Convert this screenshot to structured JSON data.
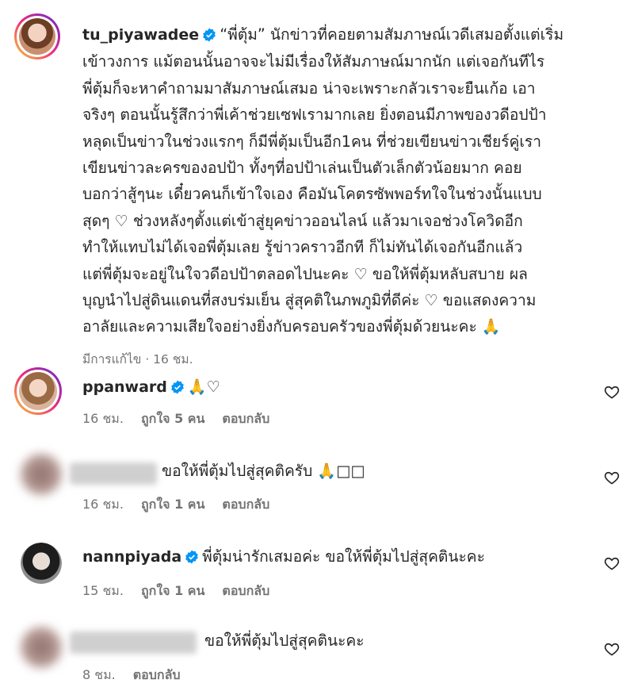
{
  "post": {
    "username": "tu_piyawadee",
    "text_lines": [
      "“พี่ตุ้ม” นักข่าวที่คอยตามสัมภาษณ์เวดีเสมอตั้งแต่เริ่ม",
      "เข้าวงการ แม้ตอนนั้นอาจจะไม่มีเรื่องให้สัมภาษณ์มากนัก แต่เจอกันทีไร",
      "พี่ตุ้มก็จะหาคำถามมาสัมภาษณ์เสมอ น่าจะเพราะกลัวเราจะยืนเก้อ เอา",
      "จริงๆ ตอนนั้นรู้สึกว่าพี่เค้าช่วยเซฟเรามากเลย ยิ่งตอนมีภาพของวดีอปป้า",
      "หลุดเป็นข่าวในช่วงแรกๆ ก็มีพี่ตุ้มเป็นอีก1คน ที่ช่วยเขียนข่าวเชียร์คู่เรา",
      "เขียนข่าวละครของอปป้า ทั้งๆที่อปป้าเล่นเป็นตัวเล็กตัวน้อยมาก คอย",
      "บอกว่าสู้ๆนะ เดี๋ยวคนก็เข้าใจเอง คือมันโคตรซัพพอร์ทใจในช่วงนั้นแบบ",
      "สุดๆ ♡ ช่วงหลังๆตั้งแต่เข้าสู่ยุคข่าวออนไลน์ แล้วมาเจอช่วงโควิดอีก",
      "ทำให้แทบไม่ได้เจอพี่ตุ้มเลย รู้ข่าวคราวอีกที ก็ไม่ทันได้เจอกันอีกแล้ว",
      "แต่พี่ตุ้มจะอยู่ในใจวดีอปป้าตลอดไปนะคะ ♡ ขอให้พี่ตุ้มหลับสบาย ผล",
      "บุญนำไปสู่ดินแดนที่สงบร่มเย็น สู่สุคติในภพภูมิที่ดีค่ะ ♡ ขอแสดงความ",
      "อาลัยและความเสียใจอย่างยิ่งกับครอบครัวของพี่ตุ้มด้วยนะคะ 🙏"
    ],
    "meta": "มีการแก้ไข · 16 ชม."
  },
  "comments": [
    {
      "username": "ppanward",
      "text": "🙏♡",
      "time": "16 ชม.",
      "likes": "ถูกใจ 5 คน",
      "reply": "ตอบกลับ"
    },
    {
      "username": "",
      "text": "ขอให้พี่ตุ้มไปสู่สุคติครับ 🙏□□",
      "time": "16 ชม.",
      "likes": "ถูกใจ 1 คน",
      "reply": "ตอบกลับ"
    },
    {
      "username": "nannpiyada",
      "text": "พี่ตุ้มน่ารักเสมอค่ะ ขอให้พี่ตุ้มไปสู่สุคตินะคะ",
      "time": "15 ชม.",
      "likes": "ถูกใจ 1 คน",
      "reply": "ตอบกลับ"
    },
    {
      "username": "",
      "text": "ขอให้พี่ตุ้มไปสู่สุคตินะคะ",
      "time": "8 ชม.",
      "reply": "ตอบกลับ"
    }
  ],
  "colors": {
    "verified": "#0095f6",
    "text": "#262626",
    "muted": "#737373"
  },
  "icons": {
    "verified": "verified-badge-icon",
    "like": "heart-outline-icon"
  }
}
